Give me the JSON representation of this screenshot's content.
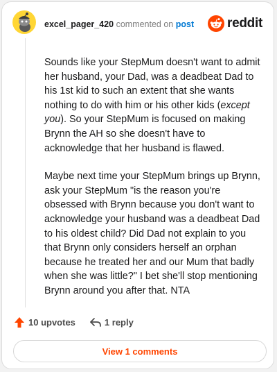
{
  "comment": {
    "username": "excel_pager_420",
    "commented_on_text": "commented on",
    "post_link_label": "post",
    "avatar_icon": "snoo-avatar-icon",
    "body": {
      "p1_a": "Sounds like your StepMum doesn't want to admit her husband, your Dad, was a deadbeat Dad to his 1st kid to such an extent that she wants nothing to do with him or his other kids (",
      "p1_em": "except you",
      "p1_b": "). So your StepMum is focused on making Brynn the AH so she doesn't have to acknowledge that her husband is flawed.",
      "p2": "Maybe next time your StepMum brings up Brynn, ask your StepMum \"is the reason you're obsessed with Brynn because you don't want to acknowledge your husband was a deadbeat Dad to his oldest child? Did Dad not explain to you that Brynn only considers herself an orphan because he treated her and our Mum that badly when she was little?\" I bet she'll stop mentioning Brynn around you after that. NTA"
    },
    "upvotes_label": "10 upvotes",
    "reply_label": "1 reply",
    "view_comments_label": "View 1 comments"
  },
  "brand": {
    "wordmark": "reddit",
    "logo_icon": "reddit-logo-icon",
    "accent_color": "#ff4500",
    "link_color": "#0079d3"
  }
}
